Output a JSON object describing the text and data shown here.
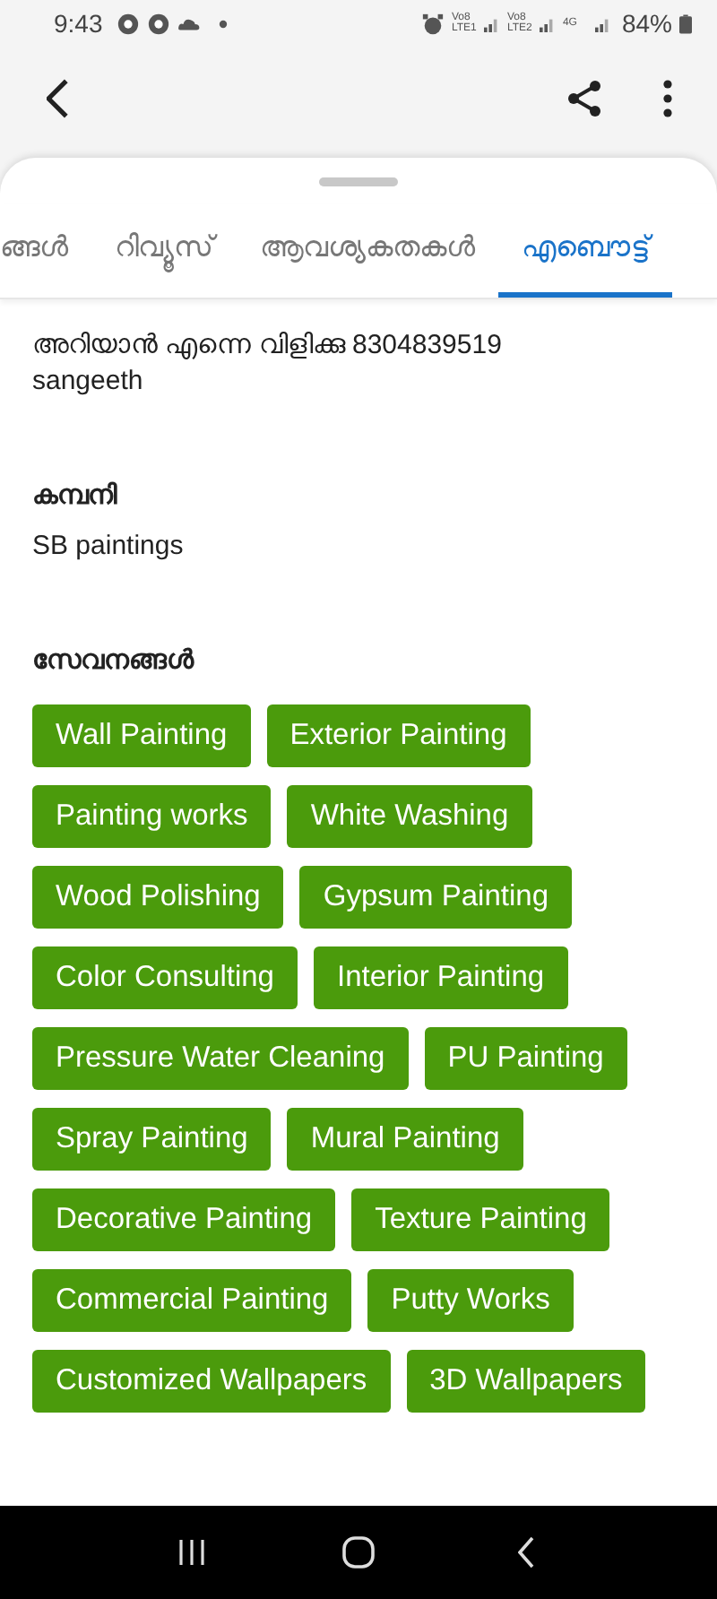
{
  "status_bar": {
    "time": "9:43",
    "network_labels": [
      "Vo8 LTE1",
      "Vo8 LTE2",
      "4G"
    ],
    "battery": "84%"
  },
  "tabs": [
    {
      "label": "ങ്ങൾ",
      "selected": false
    },
    {
      "label": "റിവ്യൂസ്",
      "selected": false
    },
    {
      "label": "ആവശ്യകതകൾ",
      "selected": false
    },
    {
      "label": "എബൌട്ട്",
      "selected": true
    }
  ],
  "about": {
    "lines": [
      "അറിയാൻ എന്നെ വിളിക്കു 8304839519",
      "sangeeth"
    ]
  },
  "company": {
    "heading": "കമ്പനി",
    "value": "SB paintings"
  },
  "services": {
    "heading": "സേവനങ്ങൾ",
    "items": [
      "Wall Painting",
      "Exterior Painting",
      "Painting works",
      "White Washing",
      "Wood Polishing",
      "Gypsum Painting",
      "Color Consulting",
      "Interior Painting",
      "Pressure Water Cleaning",
      "PU Painting",
      "Spray Painting",
      "Mural Painting",
      "Decorative Painting",
      "Texture Painting",
      "Commercial Painting",
      "Putty Works",
      "Customized Wallpapers",
      "3D Wallpapers"
    ]
  }
}
